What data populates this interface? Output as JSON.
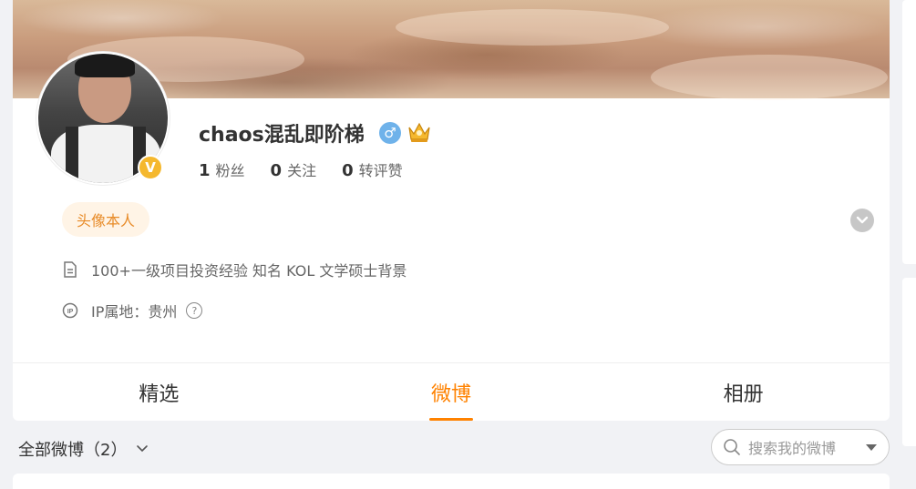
{
  "profile": {
    "username": "chaos混乱即阶梯",
    "verified_badge": "V",
    "gender_symbol": "♂",
    "gender_icon": "male-icon",
    "crown_icon": "crown-icon",
    "stats": [
      {
        "num": "1",
        "label": "粉丝"
      },
      {
        "num": "0",
        "label": "关注"
      },
      {
        "num": "0",
        "label": "转评赞"
      }
    ],
    "tag": "头像本人",
    "bio": "100+一级项目投资经验 知名 KOL 文学硕士背景",
    "ip_location": "IP属地：贵州",
    "help_symbol": "?"
  },
  "tabs": [
    {
      "label": "精选",
      "active": false
    },
    {
      "label": "微博",
      "active": true
    },
    {
      "label": "相册",
      "active": false
    }
  ],
  "filter": {
    "label": "全部微博（2）"
  },
  "search": {
    "placeholder": "搜索我的微博"
  },
  "colors": {
    "accent": "#ff8200",
    "tag_bg": "#fff4e6",
    "tag_text": "#e88b28",
    "verified": "#f5b82e",
    "gender": "#6fb2ea"
  }
}
